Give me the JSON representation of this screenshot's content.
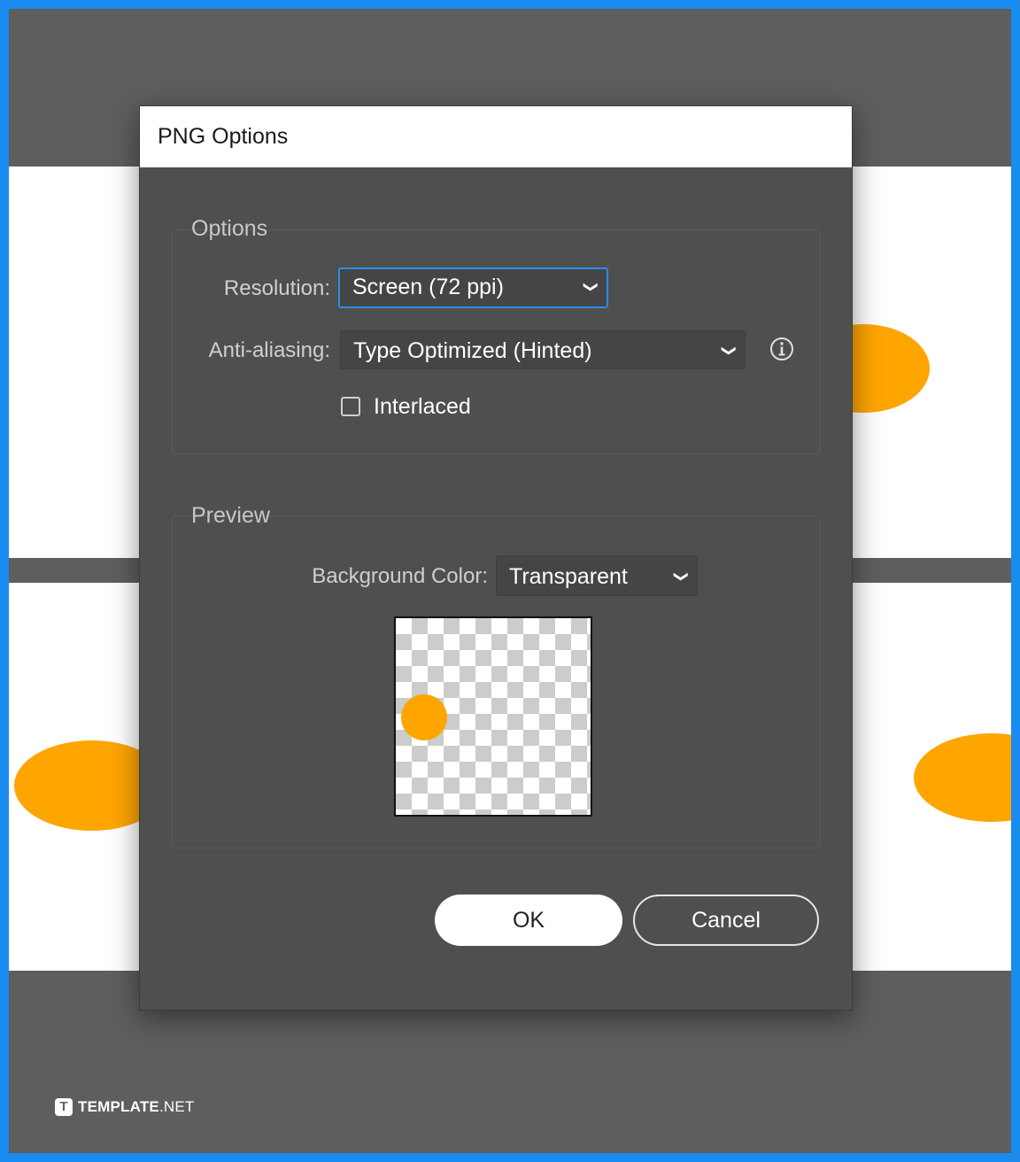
{
  "dialog": {
    "title": "PNG Options",
    "options_group": {
      "legend": "Options",
      "resolution_label": "Resolution:",
      "resolution_value": "Screen (72 ppi)",
      "antialiasing_label": "Anti-aliasing:",
      "antialiasing_value": "Type Optimized (Hinted)",
      "info_icon": "info-circle",
      "interlaced_label": "Interlaced",
      "interlaced_checked": false
    },
    "preview_group": {
      "legend": "Preview",
      "background_color_label": "Background Color:",
      "background_color_value": "Transparent"
    },
    "buttons": {
      "ok": "OK",
      "cancel": "Cancel"
    }
  },
  "watermark": {
    "mark": "T",
    "brand_bold": "TEMPLATE",
    "brand_light": ".NET"
  },
  "colors": {
    "accent": "#2d8ceb",
    "shape": "#ffa500",
    "frame_border": "#1a8cf0"
  }
}
